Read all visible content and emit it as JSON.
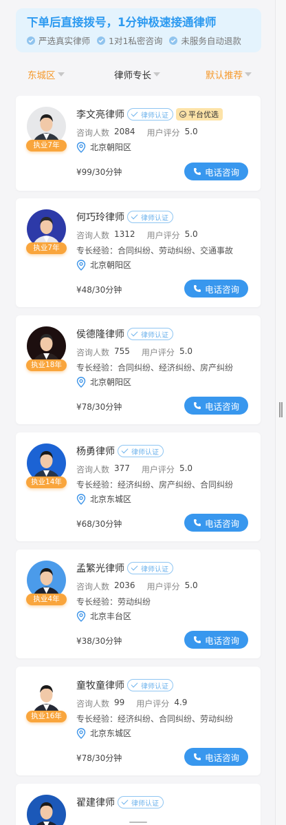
{
  "banner": {
    "title": "下单后直接拨号，1分钟极速接通律师",
    "features": [
      "严选真实律师",
      "1对1私密咨询",
      "未服务自动退款"
    ]
  },
  "filters": [
    {
      "label": "东城区",
      "active": true
    },
    {
      "label": "律师专长",
      "active": false
    },
    {
      "label": "默认推荐",
      "active": true
    }
  ],
  "labels": {
    "verified": "律师认证",
    "premium": "平台优选",
    "consult_count": "咨询人数",
    "rating": "用户评分",
    "call": "电话咨询"
  },
  "lawyers": [
    {
      "name": "李文亮律师",
      "experience": "执业7年",
      "premium": true,
      "consults": "2084",
      "rating": "5.0",
      "specialty": "",
      "location": "北京朝阳区",
      "price": "¥99/30分钟"
    },
    {
      "name": "何巧玲律师",
      "experience": "执业7年",
      "premium": false,
      "consults": "1312",
      "rating": "5.0",
      "specialty": "专长经验：合同纠纷、劳动纠纷、交通事故",
      "location": "北京朝阳区",
      "price": "¥48/30分钟"
    },
    {
      "name": "侯德隆律师",
      "experience": "执业18年",
      "premium": false,
      "consults": "755",
      "rating": "5.0",
      "specialty": "专长经验：合同纠纷、经济纠纷、房产纠纷",
      "location": "北京朝阳区",
      "price": "¥78/30分钟"
    },
    {
      "name": "杨勇律师",
      "experience": "执业14年",
      "premium": false,
      "consults": "377",
      "rating": "5.0",
      "specialty": "专长经验：经济纠纷、房产纠纷、合同纠纷",
      "location": "北京东城区",
      "price": "¥68/30分钟"
    },
    {
      "name": "孟繁光律师",
      "experience": "执业4年",
      "premium": false,
      "consults": "2036",
      "rating": "5.0",
      "specialty": "专长经验：劳动纠纷",
      "location": "北京丰台区",
      "price": "¥38/30分钟"
    },
    {
      "name": "童牧童律师",
      "experience": "执业16年",
      "premium": false,
      "consults": "99",
      "rating": "4.9",
      "specialty": "专长经验：经济纠纷、合同纠纷、劳动纠纷",
      "location": "北京东城区",
      "price": "¥78/30分钟"
    },
    {
      "name": "翟建律师",
      "experience": "",
      "premium": false,
      "consults": "",
      "rating": "",
      "specialty": "",
      "location": "",
      "price": ""
    }
  ],
  "colors": {
    "accent_blue": "#3897ee",
    "badge_orange": "#f9a53c",
    "filter_orange": "#f59a2e"
  }
}
